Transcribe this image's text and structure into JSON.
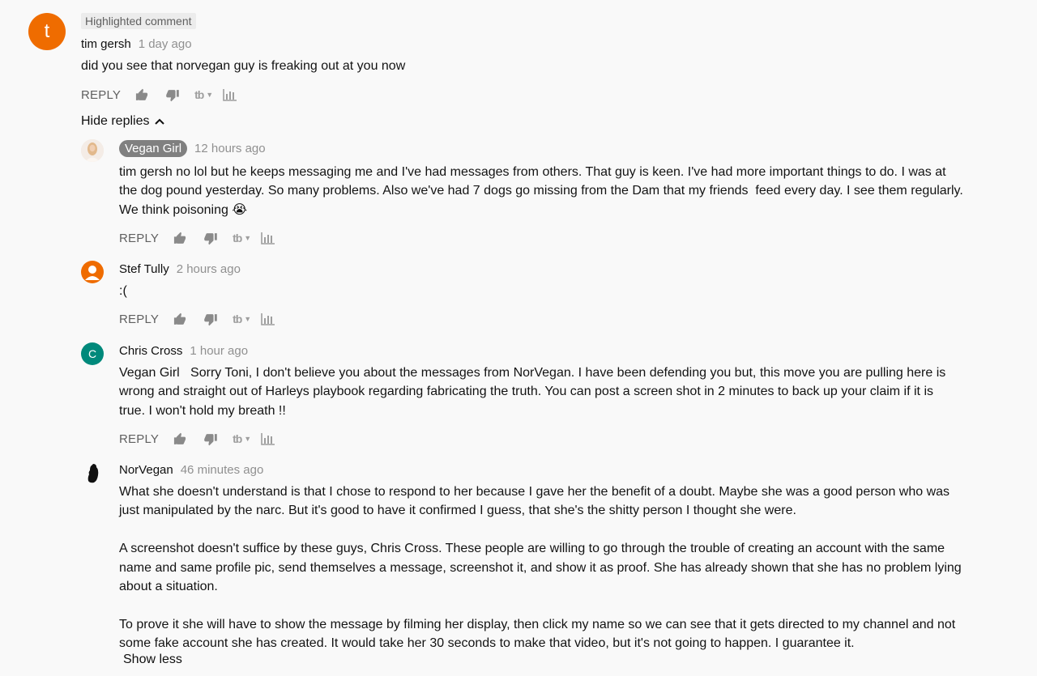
{
  "highlighted_label": "Highlighted comment",
  "colors": {
    "avatar_tim": "#ef6c00",
    "avatar_stef": "#ef6c00",
    "avatar_chris": "#00897b",
    "pill": "#808080",
    "muted": "#606060"
  },
  "top_comment": {
    "avatar_letter": "t",
    "author": "tim gersh",
    "time": "1 day ago",
    "text": "did you see that norvegan guy is freaking out at you now",
    "reply_label": "REPLY"
  },
  "hide_replies_label": "Hide replies",
  "replies": [
    {
      "author": "Vegan Girl",
      "time": "12 hours ago",
      "lines": [
        "tim gersh no lol but he keeps messaging me and I've had messages from others. That guy is keen. I've had more important things to do. I was at",
        "the dog pound yesterday. So many problems. Also we've had 7 dogs go missing from the Dam that my friends  feed every day. I see them regularly.",
        "We think poisoning"
      ],
      "emoji": "😭",
      "reply_label": "REPLY"
    },
    {
      "author": "Stef Tully",
      "time": "2 hours ago",
      "lines": [
        ":("
      ],
      "reply_label": "REPLY"
    },
    {
      "avatar_letter": "C",
      "author": "Chris Cross",
      "time": "1 hour ago",
      "lines": [
        "Vegan Girl   Sorry Toni, I don't believe you about the messages from NorVegan. I have been defending you but, this move you are pulling here is",
        "wrong and straight out of Harleys playbook regarding fabricating the truth. You can post a screen shot in 2 minutes to back up your claim if it is",
        "true. I won't hold my breath !!"
      ],
      "reply_label": "REPLY"
    },
    {
      "author": "NorVegan",
      "time": "46 minutes ago",
      "paragraphs": [
        [
          "What she doesn't understand is that I chose to respond to her because I gave her the benefit of a doubt. Maybe she was a good person who was",
          "just manipulated by the narc. But it's good to have it confirmed I guess, that she's the shitty person I thought she were."
        ],
        [
          "A screenshot doesn't suffice by these guys, Chris Cross. These people are willing to go through the trouble of creating an account with the same",
          "name and same profile pic, send themselves a message, screenshot it, and show it as proof. She has already shown that she has no problem lying",
          "about a situation."
        ],
        [
          "To prove it she will have to show the message by filming her display, then click my name so we can see that it gets directed to my channel and not",
          "some fake account she has created. It would take her 30 seconds to make that video, but it's not going to happen. I guarantee it."
        ]
      ],
      "show_less_label": "Show less"
    }
  ],
  "icons": [
    "thumbs-up-icon",
    "thumbs-down-icon",
    "tubebuddy-icon",
    "stats-icon",
    "chevron-up-icon"
  ],
  "tubebuddy_label": "tb"
}
